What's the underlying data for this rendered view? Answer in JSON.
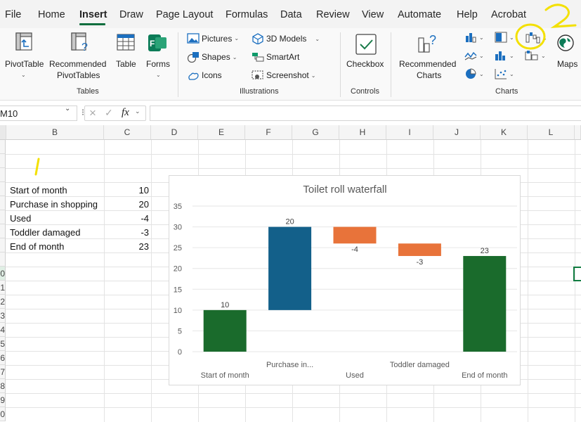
{
  "menu": {
    "tabs": [
      {
        "label": "File"
      },
      {
        "label": "Home"
      },
      {
        "label": "Insert",
        "active": true
      },
      {
        "label": "Draw"
      },
      {
        "label": "Page Layout"
      },
      {
        "label": "Formulas"
      },
      {
        "label": "Data"
      },
      {
        "label": "Review"
      },
      {
        "label": "View"
      },
      {
        "label": "Automate"
      },
      {
        "label": "Help"
      },
      {
        "label": "Acrobat"
      }
    ]
  },
  "ribbon": {
    "tables": {
      "group_label": "Tables",
      "pivot_table": "PivotTable",
      "recommended_pivot": [
        "Recommended",
        "PivotTables"
      ],
      "table": "Table",
      "forms": "Forms"
    },
    "illustrations": {
      "group_label": "Illustrations",
      "pictures": "Pictures",
      "shapes": "Shapes",
      "icons": "Icons",
      "models_3d": "3D Models",
      "smartart": "SmartArt",
      "screenshot": "Screenshot"
    },
    "controls": {
      "group_label": "Controls",
      "checkbox": "Checkbox"
    },
    "charts": {
      "group_label": "Charts",
      "recommended_charts": [
        "Recommended",
        "Charts"
      ],
      "maps": "Maps"
    }
  },
  "formula_bar": {
    "name_box": "M10",
    "fx": "fx",
    "value": ""
  },
  "grid": {
    "columns": [
      "B",
      "C",
      "D",
      "E",
      "F",
      "G",
      "H",
      "I",
      "J",
      "K",
      "L"
    ],
    "rows": [
      "",
      "",
      "",
      "",
      "",
      "",
      "",
      "",
      "",
      "0",
      "1",
      "2",
      "3",
      "4",
      "5",
      "6",
      "7",
      "8",
      "9",
      "0"
    ],
    "table": [
      {
        "label": "Start of month",
        "value": "10"
      },
      {
        "label": "Purchase in shopping",
        "value": "20"
      },
      {
        "label": "Used",
        "value": "-4"
      },
      {
        "label": "Toddler damaged",
        "value": "-3"
      },
      {
        "label": "End of month",
        "value": "23"
      }
    ]
  },
  "annotations": {
    "step1": "/",
    "step2": "2",
    "step1_color": "#f3e000",
    "step2_color": "#f3e000"
  },
  "colors": {
    "total": "#1a6b2c",
    "increase": "#13608a",
    "decrease": "#e8733a",
    "accent": "#0f6e3e"
  },
  "chart_data": {
    "type": "bar",
    "subtype": "waterfall",
    "title": "Toilet roll waterfall",
    "categories": [
      "Start of month",
      "Purchase in...",
      "Used",
      "Toddler damaged",
      "End of month"
    ],
    "values": [
      10,
      20,
      -4,
      -3,
      23
    ],
    "data_labels": [
      "10",
      "20",
      "-4",
      "-3",
      "23"
    ],
    "kinds": [
      "total",
      "increase",
      "decrease",
      "decrease",
      "total"
    ],
    "ylim": [
      0,
      35
    ],
    "yticks": [
      0,
      5,
      10,
      15,
      20,
      25,
      30,
      35
    ],
    "grid": true,
    "legend": "none"
  }
}
